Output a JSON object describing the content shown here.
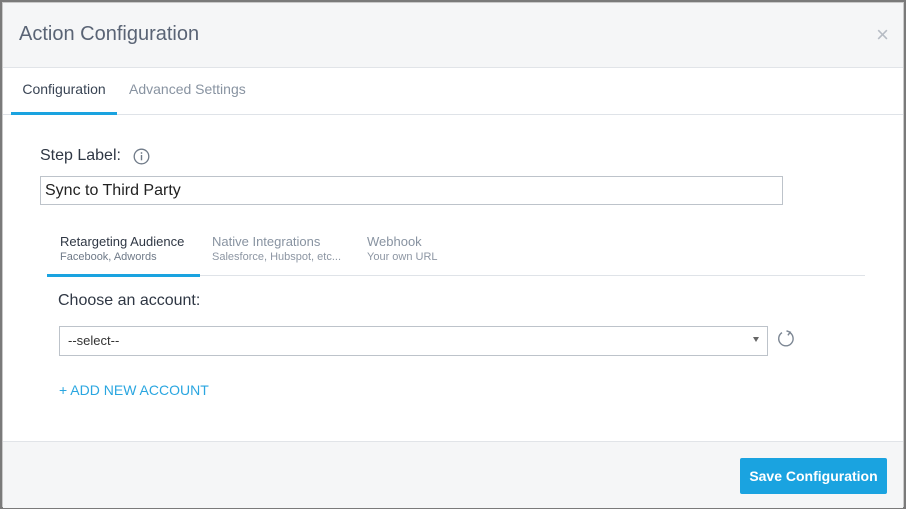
{
  "modal": {
    "title": "Action Configuration",
    "close_glyph": "×"
  },
  "tabs": [
    {
      "label": "Configuration",
      "active": true
    },
    {
      "label": "Advanced Settings",
      "active": false
    }
  ],
  "step_label": {
    "label": "Step Label:",
    "value": "Sync to Third Party",
    "info_icon": "info-icon"
  },
  "subtabs": [
    {
      "title": "Retargeting Audience",
      "subtitle": "Facebook, Adwords",
      "active": true
    },
    {
      "title": "Native Integrations",
      "subtitle": "Salesforce, Hubspot, etc...",
      "active": false
    },
    {
      "title": "Webhook",
      "subtitle": "Your own URL",
      "active": false
    }
  ],
  "account": {
    "label": "Choose an account:",
    "selected": "--select--",
    "refresh_icon": "refresh-icon",
    "add_label": "+ ADD NEW ACCOUNT"
  },
  "footer": {
    "save_label": "Save Configuration"
  },
  "colors": {
    "accent": "#1aa3e0",
    "header_bg": "#f5f6f7",
    "title_text": "#5a6475"
  }
}
